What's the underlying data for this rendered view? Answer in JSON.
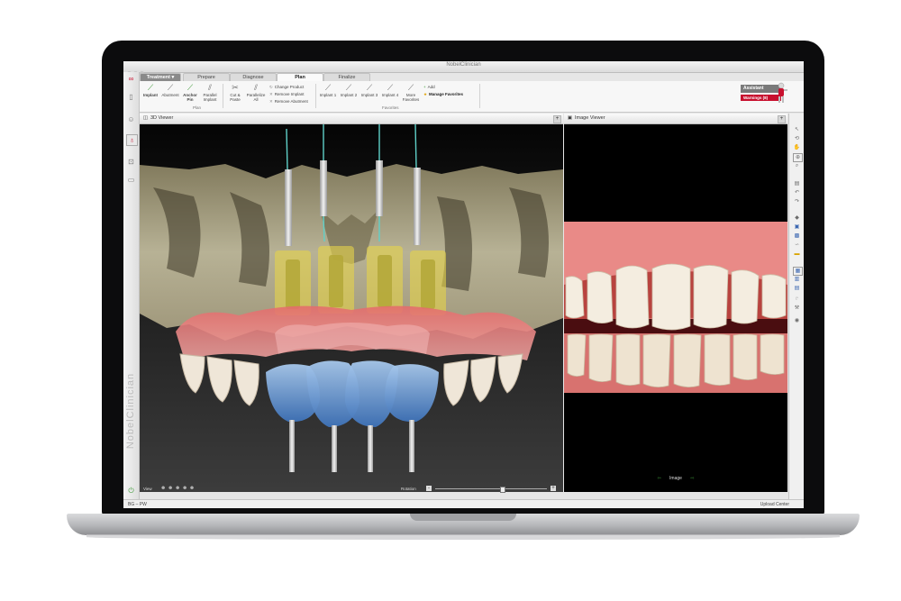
{
  "window": {
    "title": "NobelClinician"
  },
  "tabs": [
    {
      "label": "Treatment"
    },
    {
      "label": "Prepare"
    },
    {
      "label": "Diagnose"
    },
    {
      "label": "Plan"
    },
    {
      "label": "Finalize"
    }
  ],
  "ribbon": {
    "buttons": [
      {
        "label": "Implant",
        "icon": "implant-icon"
      },
      {
        "label": "Abutment",
        "icon": "abutment-icon"
      },
      {
        "label": "Anchor Pin",
        "icon": "anchor-pin-icon"
      },
      {
        "label": "Parallel Implant",
        "icon": "parallel-implant-icon"
      },
      {
        "label": "Cut & Paste",
        "icon": "cut-paste-icon"
      },
      {
        "label": "Parallelize All",
        "icon": "parallelize-icon"
      }
    ],
    "product_menu": [
      {
        "label": "Change Product"
      },
      {
        "label": "Remove Implant"
      },
      {
        "label": "Remove Abutment"
      }
    ],
    "favorites": [
      {
        "label": "Implant 1"
      },
      {
        "label": "Implant 2"
      },
      {
        "label": "Implant 3"
      },
      {
        "label": "Implant 4"
      },
      {
        "label": "More Favorites"
      }
    ],
    "favorites_menu": [
      {
        "label": "Add"
      },
      {
        "label": "Manage Favorites"
      }
    ],
    "group_plan": "Plan",
    "group_favorites": "Favorites"
  },
  "assistant": {
    "label": "Assistant",
    "warnings": "Warnings (8)"
  },
  "sidebar": {
    "brand": "NobelClinician"
  },
  "viewer3d": {
    "title": "3D Viewer",
    "view_label": "View",
    "rotation_label": "Rotation",
    "rotation_value": 0.6
  },
  "image_viewer": {
    "title": "Image Viewer",
    "nav_label": "Image"
  },
  "status": {
    "left": "BG – PW",
    "right": "Upload Center"
  },
  "colors": {
    "accent_red": "#c8102e",
    "implant_green": "#3f9a3a",
    "restoration_blue": "#4b7fc2"
  }
}
